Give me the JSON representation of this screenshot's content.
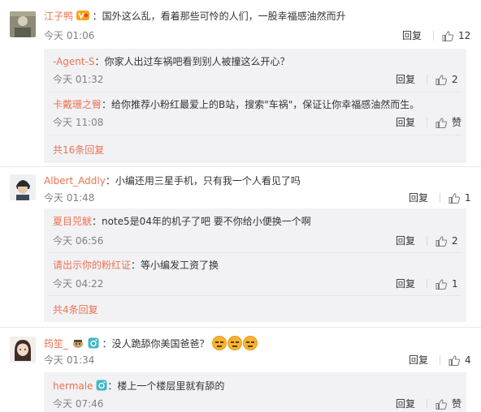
{
  "labels": {
    "reply": "回复",
    "like_word": "赞"
  },
  "comments": [
    {
      "name": "江子鸭",
      "text": "：国外这么乱，看着那些可怜的人们，一股幸福感油然而升",
      "time": "今天 01:06",
      "likes": "12",
      "replies": [
        {
          "name": "-Agent-S",
          "text": "：你家人出过车祸吧看到别人被撞这么开心？",
          "time": "今天 01:32",
          "likes": "2"
        },
        {
          "name": "卡戴珊之臀",
          "text": "：给你推荐小粉红最爱上的B站，搜索\"车祸\"，保证让你幸福感油然而生。",
          "time": "今天 11:08",
          "likes": "赞"
        }
      ],
      "more": "共16条回复"
    },
    {
      "name": "Albert_Addly",
      "text": "：小编还用三星手机，只有我一个人看见了吗",
      "time": "今天 01:48",
      "likes": "1",
      "replies": [
        {
          "name": "夏目兕觥",
          "text": "：note5是04年的机子了吧 要不你给小便换一个啊",
          "time": "今天 06:56",
          "likes": "2"
        },
        {
          "name": "请出示你的粉红证",
          "text": "：等小编发工资了换",
          "time": "今天 04:22",
          "likes": "1"
        }
      ],
      "more": "共4条回复"
    },
    {
      "name": "筠笙_",
      "text": "：没人跪舔你美国爸爸？",
      "time": "今天 01:34",
      "likes": "4",
      "replies": [
        {
          "name": "hermale",
          "text": "：楼上一个楼层里就有舔的",
          "time": "今天 07:46",
          "likes": "赞"
        }
      ]
    }
  ],
  "colors": {
    "name": "#eb7350",
    "time": "#808080",
    "subbox": "#f2f2f5"
  }
}
